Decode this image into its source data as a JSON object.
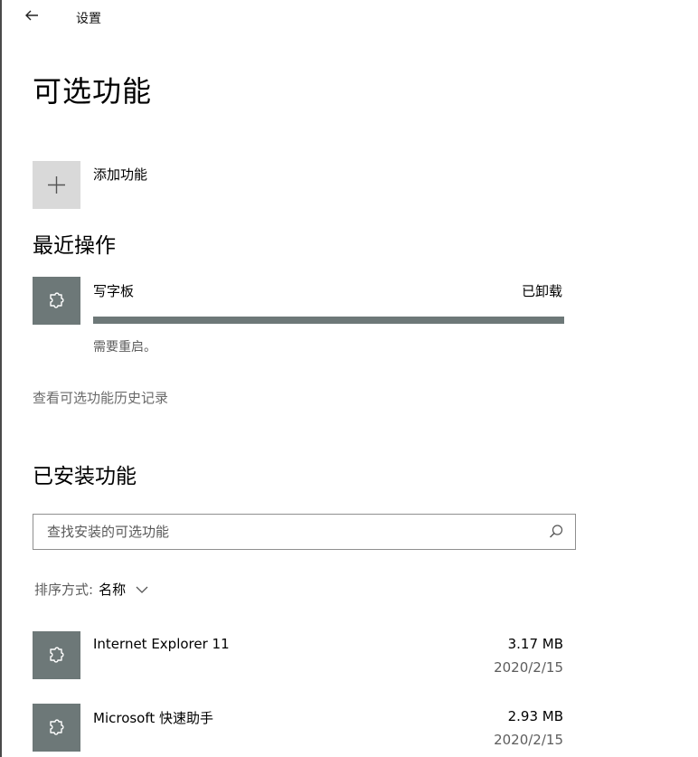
{
  "header": {
    "title": "设置"
  },
  "page": {
    "title": "可选功能"
  },
  "add_feature": {
    "label": "添加功能"
  },
  "recent": {
    "heading": "最近操作",
    "item": {
      "name": "写字板",
      "status": "已卸载",
      "progress": 1.0,
      "note": "需要重启。"
    }
  },
  "history_link": "查看可选功能历史记录",
  "installed": {
    "heading": "已安装功能",
    "search": {
      "placeholder": "查找安装的可选功能",
      "value": ""
    },
    "sort": {
      "label": "排序方式:",
      "value": "名称"
    },
    "items": [
      {
        "name": "Internet Explorer 11",
        "size": "3.17 MB",
        "date": "2020/2/15"
      },
      {
        "name": "Microsoft 快速助手",
        "size": "2.93 MB",
        "date": "2020/2/15"
      }
    ]
  },
  "colors": {
    "tile": "#6d7878",
    "add_tile": "#d9d9d9",
    "progress": "#6d7878"
  },
  "icons": [
    "back-arrow-icon",
    "plus-icon",
    "puzzle-piece-icon",
    "search-icon",
    "chevron-down-icon"
  ]
}
